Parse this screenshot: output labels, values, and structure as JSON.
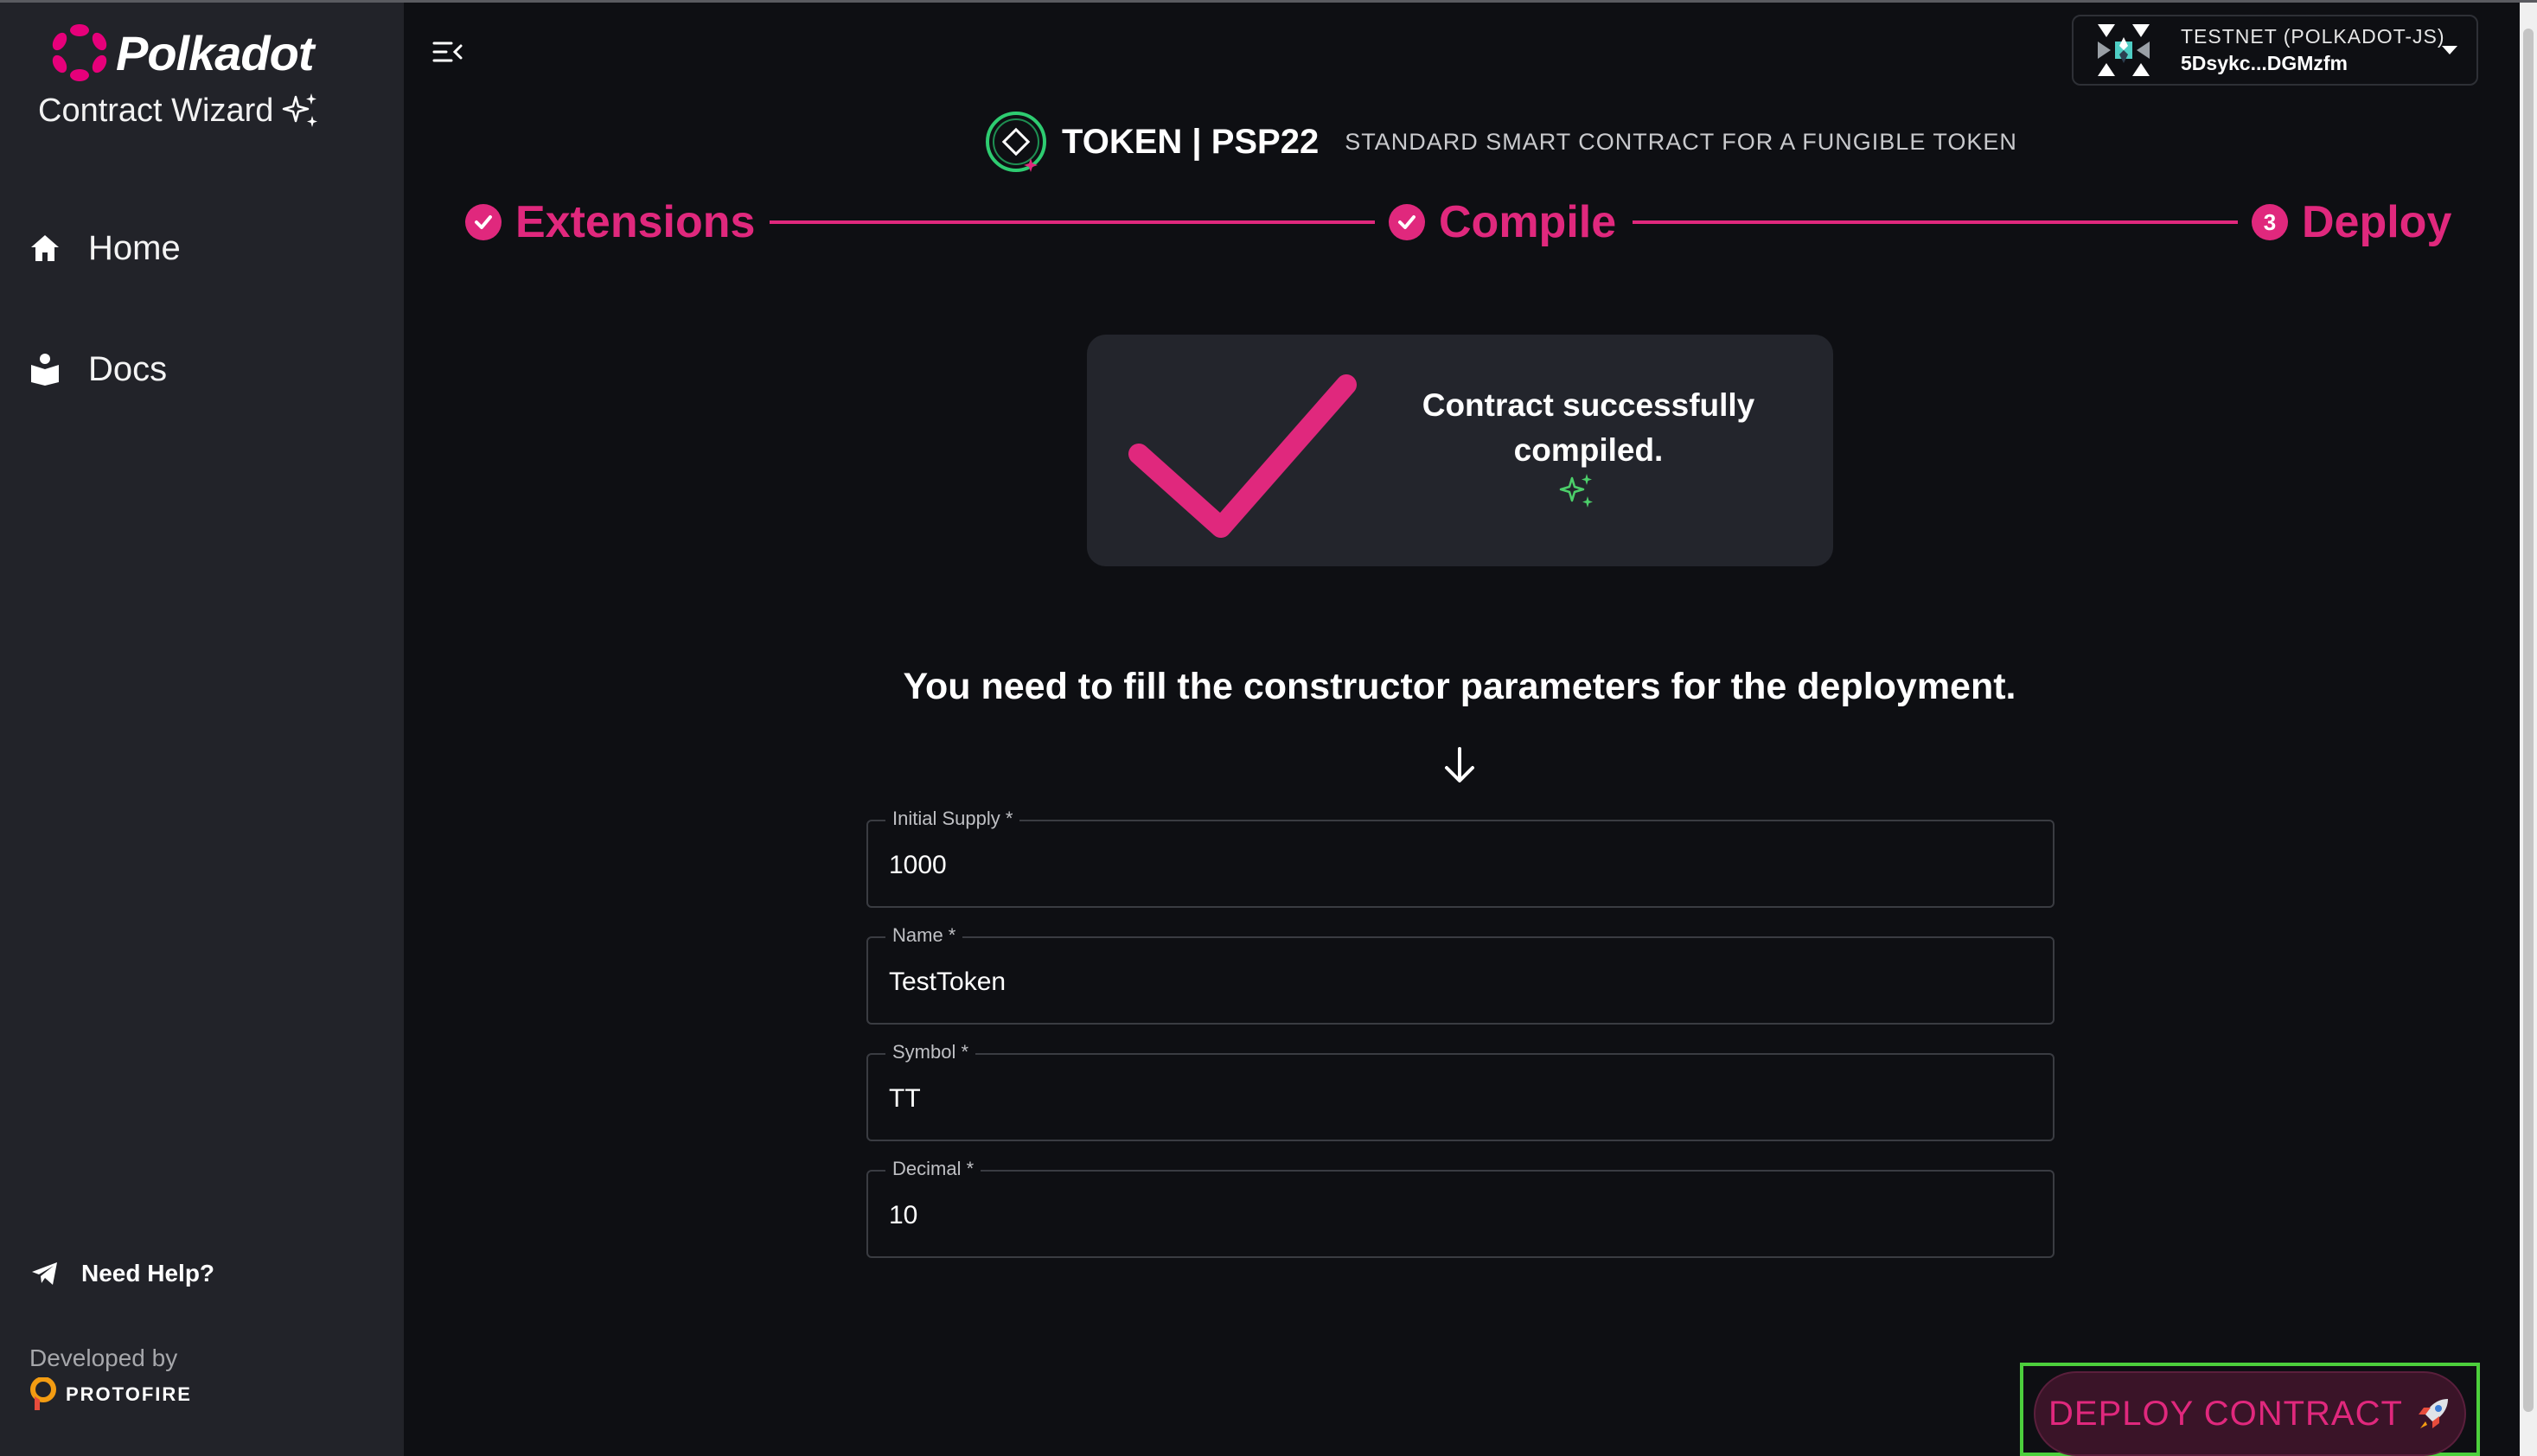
{
  "sidebar": {
    "brand": "Polkadot",
    "subtitle": "Contract Wizard",
    "nav": [
      {
        "label": "Home",
        "icon": "home-icon"
      },
      {
        "label": "Docs",
        "icon": "docs-icon"
      }
    ],
    "help": "Need Help?",
    "developed_by": "Developed by",
    "developer": "PROTOFIRE"
  },
  "wallet": {
    "network": "TESTNET (POLKADOT-JS)",
    "address": "5Dsykc...DGMzfm"
  },
  "token": {
    "title": "TOKEN | PSP22",
    "subtitle": "STANDARD SMART CONTRACT FOR A FUNGIBLE TOKEN"
  },
  "steps": [
    {
      "label": "Extensions",
      "status": "done"
    },
    {
      "label": "Compile",
      "status": "done"
    },
    {
      "label": "Deploy",
      "number": "3",
      "status": "active"
    }
  ],
  "success": {
    "message": "Contract successfully compiled."
  },
  "instruction": "You need to fill the constructor parameters for the deployment.",
  "fields": [
    {
      "label": "Initial Supply *",
      "value": "1000"
    },
    {
      "label": "Name *",
      "value": "TestToken"
    },
    {
      "label": "Symbol *",
      "value": "TT"
    },
    {
      "label": "Decimal *",
      "value": "10"
    }
  ],
  "deploy_button": "DEPLOY CONTRACT",
  "colors": {
    "accent": "#e0287d",
    "background": "#0e0f13",
    "sidebar": "#222329",
    "card": "#23252c",
    "highlight": "#4ccf3c",
    "sparkle": "#4ccf6a"
  }
}
